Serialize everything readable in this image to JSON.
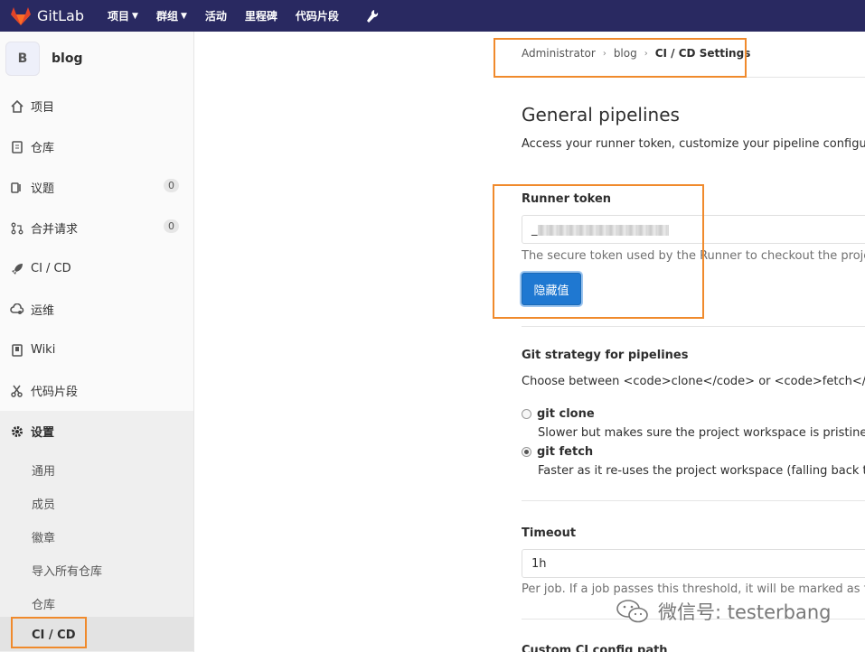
{
  "topbar": {
    "brand": "GitLab",
    "nav": [
      {
        "label": "项目",
        "dropdown": true
      },
      {
        "label": "群组",
        "dropdown": true
      },
      {
        "label": "活动",
        "dropdown": false
      },
      {
        "label": "里程碑",
        "dropdown": false
      },
      {
        "label": "代码片段",
        "dropdown": false
      }
    ],
    "admin_icon": "wrench-icon"
  },
  "sidebar": {
    "project_initial": "B",
    "project_name": "blog",
    "items": [
      {
        "label": "项目",
        "icon": "home-icon"
      },
      {
        "label": "仓库",
        "icon": "doc-icon"
      },
      {
        "label": "议题",
        "icon": "issues-icon",
        "count": "0"
      },
      {
        "label": "合并请求",
        "icon": "merge-request-icon",
        "count": "0"
      },
      {
        "label": "CI / CD",
        "icon": "rocket-icon"
      },
      {
        "label": "运维",
        "icon": "cloud-gear-icon"
      },
      {
        "label": "Wiki",
        "icon": "book-icon"
      },
      {
        "label": "代码片段",
        "icon": "scissors-icon"
      },
      {
        "label": "设置",
        "icon": "gear-icon"
      }
    ],
    "settings_sub": [
      "通用",
      "成员",
      "徽章",
      "导入所有仓库",
      "仓库",
      "CI / CD"
    ]
  },
  "breadcrumb": [
    "Administrator",
    "blog",
    "CI / CD Settings"
  ],
  "section": {
    "title": "General pipelines",
    "description": "Access your runner token, customize your pipeline configurati"
  },
  "runner_token": {
    "label": "Runner token",
    "value_prefix": "_",
    "help": "The secure token used by the Runner to checkout the project",
    "button": "隐藏值"
  },
  "git_strategy": {
    "title": "Git strategy for pipelines",
    "description": "Choose between <code>clone</code> or <code>fetch</code> to",
    "options": [
      {
        "label": "git clone",
        "help": "Slower but makes sure the project workspace is pristine as",
        "checked": false
      },
      {
        "label": "git fetch",
        "help": "Faster as it re-uses the project workspace (falling back to cl",
        "checked": true
      }
    ]
  },
  "timeout": {
    "label": "Timeout",
    "value": "1h",
    "help": "Per job. If a job passes this threshold, it will be marked as faile"
  },
  "next_section_label": "Custom CI config path",
  "watermark": "微信号: testerbang",
  "colors": {
    "topbar": "#292961",
    "primary": "#1f78d1",
    "highlight": "#f08a2c",
    "logo": "#e24329"
  }
}
